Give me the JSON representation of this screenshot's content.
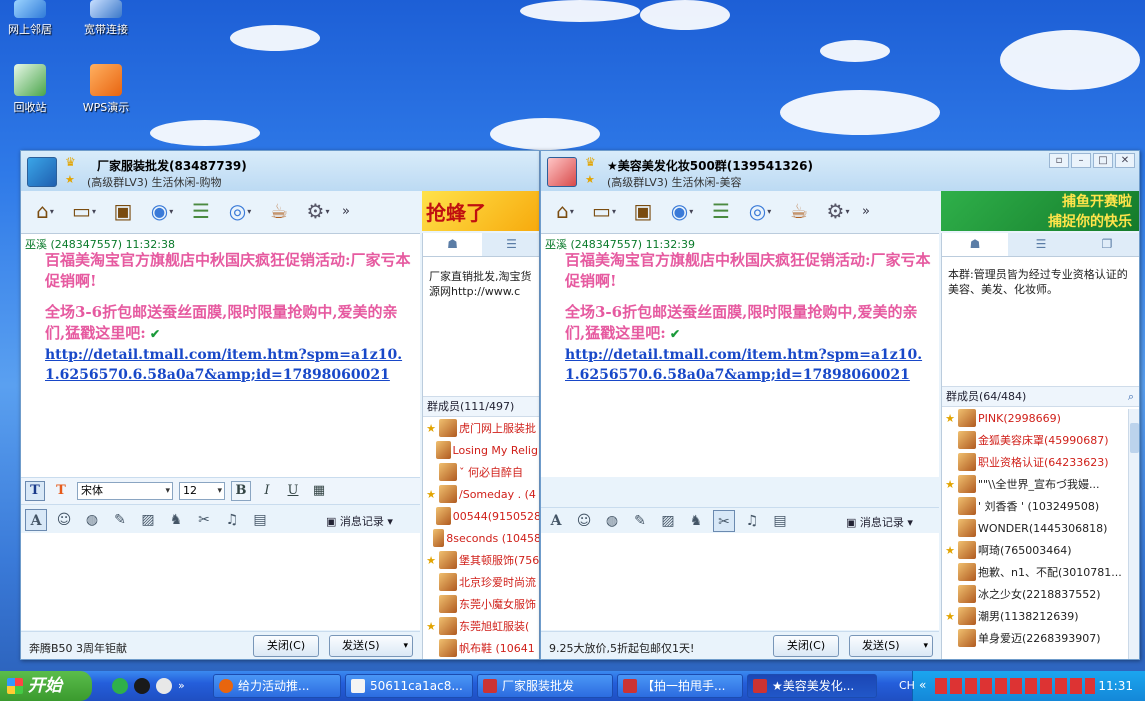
{
  "desktop": {
    "icons": [
      {
        "label": "网上邻居"
      },
      {
        "label": "宽带连接"
      },
      {
        "label": "回收站"
      },
      {
        "label": "WPS演示"
      }
    ]
  },
  "window1": {
    "group_name": "厂家服装批发(83487739)",
    "group_sub": "(高级群LV3) 生活休闲-购物",
    "ad_text": "抢蜂了",
    "sender": "巫溪 (248347557)  11:32:38",
    "msg_line1": "百福美淘宝官方旗舰店中秋国庆疯狂促销活动:厂家亏本促销啊!",
    "msg_line2": "全场3-6折包邮送蚕丝面膜,限时限量抢购中,爱美的亲们,猛戳这里吧:",
    "link": "http://detail.tmall.com/item.htm?spm=a1z10.1.6256570.6.58a0a7&amp;id=17898060021",
    "font_name": "宋体",
    "font_size": "12",
    "history_label": "消息记录",
    "status": "奔腾B50 3周年钜献",
    "close_label": "关闭(C)",
    "send_label": "发送(S)",
    "announcement": "厂家直销批发,淘宝货源网http://www.c",
    "members_header": "群成员(111/497)",
    "members": [
      {
        "name": "虎门网上服装批",
        "color": "red"
      },
      {
        "name": "Losing My Religi",
        "color": "red"
      },
      {
        "name": "ˇ   何必自醉自",
        "color": "red"
      },
      {
        "name": "/Someday . (4",
        "color": "red"
      },
      {
        "name": "00544(9150528",
        "color": "red"
      },
      {
        "name": "8seconds (10458",
        "color": "red"
      },
      {
        "name": "堡其顿服饰(756",
        "color": "red"
      },
      {
        "name": "北京珍爱时尚流",
        "color": "red"
      },
      {
        "name": "东莞小魔女服饰",
        "color": "red"
      },
      {
        "name": "东莞旭虹服装(",
        "color": "red"
      },
      {
        "name": "帆布鞋  (10641",
        "color": "red"
      }
    ]
  },
  "window2": {
    "group_name": "★美容美发化妆500群(139541326)",
    "group_sub": "(高级群LV3) 生活休闲-美容",
    "ad_text1": "捕鱼开赛啦",
    "ad_text2": "捕捉你的快乐",
    "sender": "巫溪 (248347557)  11:32:39",
    "msg_line1": "百福美淘宝官方旗舰店中秋国庆疯狂促销活动:厂家亏本促销啊!",
    "msg_line2": "全场3-6折包邮送蚕丝面膜,限时限量抢购中,爱美的亲们,猛戳这里吧:",
    "link": "http://detail.tmall.com/item.htm?spm=a1z10.1.6256570.6.58a0a7&amp;id=17898060021",
    "history_label": "消息记录",
    "status": "9.25大放价,5折起包邮仅1天!",
    "close_label": "关闭(C)",
    "send_label": "发送(S)",
    "announcement": "本群:管理员皆为经过专业资格认证的美容、美发、化妆师。",
    "members_header": "群成员(64/484)",
    "members": [
      {
        "name": "PINK(2998669)",
        "color": "red"
      },
      {
        "name": "金狐美容床罩(45990687)",
        "color": "red"
      },
      {
        "name": "职业资格认证(64233623)",
        "color": "red"
      },
      {
        "name": "\"\"\\\\全世界_宣布づ我嫚...",
        "color": "black"
      },
      {
        "name": "' 刘香香 ' (103249508)",
        "color": "black"
      },
      {
        "name": "WONDER(1445306818)",
        "color": "black"
      },
      {
        "name": "啊琦(765003464)",
        "color": "black"
      },
      {
        "name": "抱歉、n1、不配(3010781...",
        "color": "black"
      },
      {
        "name": "冰之少女(2218837552)",
        "color": "black"
      },
      {
        "name": "潮男(1138212639)",
        "color": "black"
      },
      {
        "name": "单身爱迈(2268393907)",
        "color": "black"
      }
    ]
  },
  "taskbar": {
    "start_label": "开始",
    "tasks": [
      {
        "label": "给力活动推..."
      },
      {
        "label": "50611ca1ac8..."
      },
      {
        "label": "厂家服装批发"
      },
      {
        "label": "【拍一拍甩手..."
      },
      {
        "label": "★美容美发化..."
      }
    ],
    "lang": "CH",
    "clock": "11:31"
  }
}
